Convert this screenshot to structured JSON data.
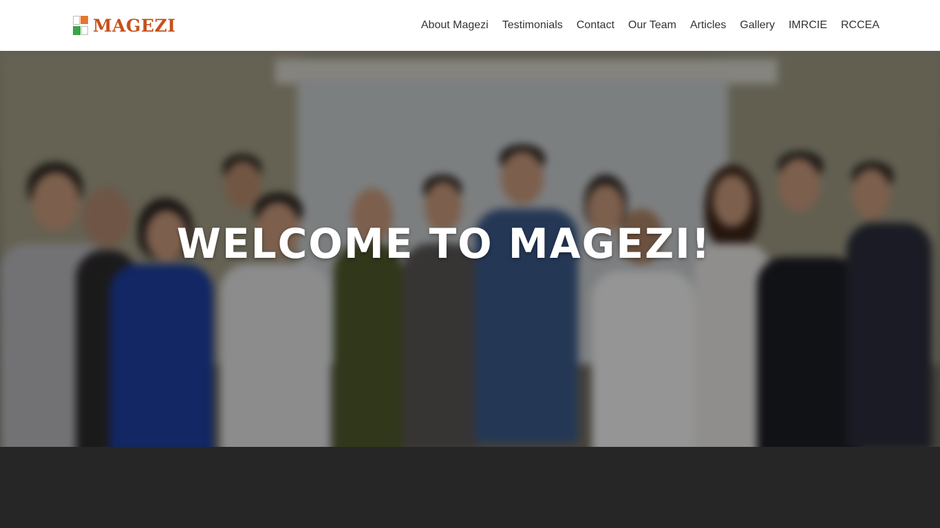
{
  "brand": {
    "name": "MAGEZI",
    "logo_icon": "four-square-logo-icon",
    "color": "#c6501b"
  },
  "nav": {
    "items": [
      {
        "label": "About Magezi"
      },
      {
        "label": "Testimonials"
      },
      {
        "label": "Contact"
      },
      {
        "label": "Our Team"
      },
      {
        "label": "Articles"
      },
      {
        "label": "Gallery"
      },
      {
        "label": "IMRCIE"
      },
      {
        "label": "RCCEA"
      }
    ]
  },
  "hero": {
    "title": "WELCOME TO MAGEZI!",
    "background_image": "group-photo"
  },
  "colors": {
    "accent": "#c6501b",
    "logo_orange": "#e8762b",
    "logo_green": "#3aa547",
    "footer_bg": "#262626"
  }
}
